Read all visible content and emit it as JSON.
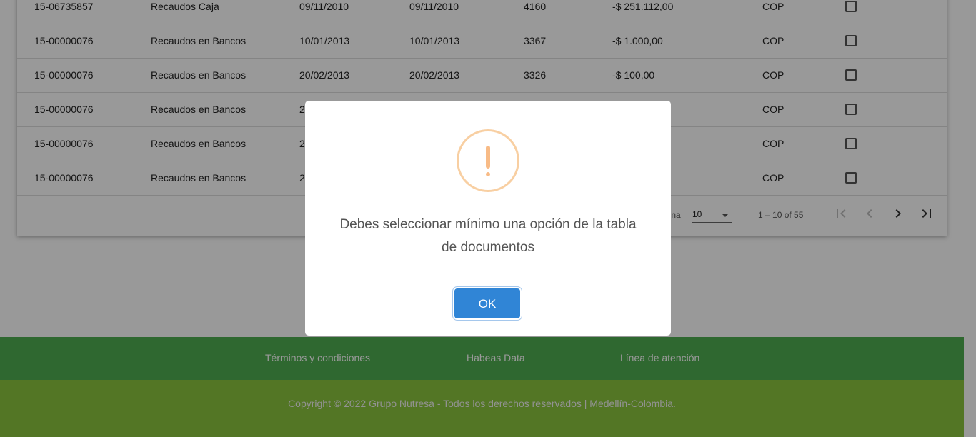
{
  "table": {
    "rows": [
      {
        "doc": "15-06735857",
        "tipo": "Recaudos Caja",
        "fecha1": "09/11/2010",
        "fecha2": "09/11/2010",
        "num": "4160",
        "valor": "-$ 251.112,00",
        "moneda": "COP"
      },
      {
        "doc": "15-00000076",
        "tipo": "Recaudos en Bancos",
        "fecha1": "10/01/2013",
        "fecha2": "10/01/2013",
        "num": "3367",
        "valor": "-$ 1.000,00",
        "moneda": "COP"
      },
      {
        "doc": "15-00000076",
        "tipo": "Recaudos en Bancos",
        "fecha1": "20/02/2013",
        "fecha2": "20/02/2013",
        "num": "3326",
        "valor": "-$ 100,00",
        "moneda": "COP"
      },
      {
        "doc": "15-00000076",
        "tipo": "Recaudos en Bancos",
        "fecha1": "2",
        "fecha2": "",
        "num": "",
        "valor": "",
        "moneda": "COP"
      },
      {
        "doc": "15-00000076",
        "tipo": "Recaudos en Bancos",
        "fecha1": "2",
        "fecha2": "",
        "num": "",
        "valor": "",
        "moneda": "COP"
      },
      {
        "doc": "15-00000076",
        "tipo": "Recaudos en Bancos",
        "fecha1": "2",
        "fecha2": "",
        "num": "",
        "valor": "",
        "moneda": "COP"
      }
    ]
  },
  "paginator": {
    "label": "gina",
    "page_size": "10",
    "range": "1 – 10 of 55"
  },
  "dialog": {
    "message": "Debes seleccionar mínimo una opción de la tabla de documentos",
    "ok_label": "OK"
  },
  "footer": {
    "links": [
      "Términos y condiciones",
      "Habeas Data",
      "Línea de atención"
    ],
    "copyright": "Copyright © 2022 Grupo Nutresa - Todos los derechos reservados | Medellín-Colombia."
  },
  "colors": {
    "footer_top": "#4fae50",
    "footer_bottom": "#8bc53f",
    "ok_button": "#3085d6",
    "warning": "#f8bb86"
  },
  "icons": {
    "warning": "exclamation-circle-icon",
    "first_page": "first-page-icon",
    "prev_page": "chevron-left-icon",
    "next_page": "chevron-right-icon",
    "last_page": "last-page-icon"
  }
}
